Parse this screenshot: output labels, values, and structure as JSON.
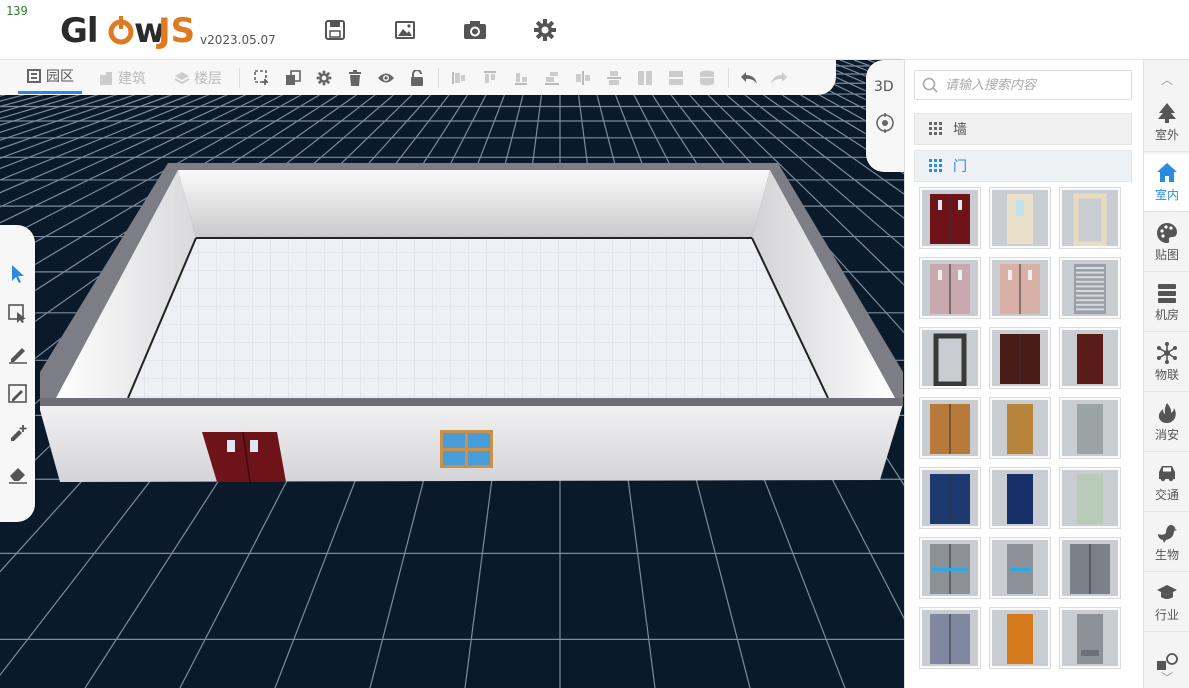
{
  "fps": "139",
  "app": {
    "logo_main": "GlowJS",
    "logo_a": "Gl",
    "logo_b": "w",
    "logo_c": "JS",
    "version": "v2023.05.07"
  },
  "header_icons": [
    "save-icon",
    "image-icon",
    "camera-icon",
    "gear-icon"
  ],
  "toolbar": {
    "tabs": [
      {
        "label": "园区",
        "icon": "park-icon",
        "active": true
      },
      {
        "label": "建筑",
        "icon": "building-icon",
        "active": false
      },
      {
        "label": "楼层",
        "icon": "layers-icon",
        "active": false
      }
    ],
    "actions": [
      "add-object-icon",
      "copy-icon",
      "settings-icon",
      "trash-icon",
      "eye-icon",
      "unlock-icon"
    ],
    "align_actions": [
      "align-left-icon",
      "align-top-icon",
      "align-bottom-left-icon",
      "align-bottom-icon",
      "distribute-h-icon",
      "distribute-v-icon",
      "split-v-icon",
      "split-h-icon",
      "stack-icon"
    ],
    "history": [
      "undo-icon",
      "redo-icon"
    ]
  },
  "left_tools": [
    "select-arrow-icon",
    "box-select-icon",
    "draw-line-icon",
    "edit-shape-icon",
    "add-point-icon",
    "eraser-icon"
  ],
  "view": {
    "mode_label": "3D"
  },
  "asset_panel": {
    "search_placeholder": "请输入搜索内容",
    "categories": [
      {
        "label": "墙",
        "active": false
      },
      {
        "label": "门",
        "active": true
      }
    ],
    "door_thumbnails": [
      "dark-red-double-door",
      "cream-glass-door",
      "door-frame",
      "pink-double-door",
      "peach-double-door",
      "louvered-vent-door",
      "dark-frame-door",
      "brown-double-door",
      "brown-single-door",
      "wood-double-door",
      "wood-single-door",
      "grey-single-door",
      "blue-double-door",
      "navy-single-door",
      "pale-green-door",
      "grey-panic-bar-double-door",
      "grey-panic-bar-door",
      "grey-double-door",
      "grey-double-door-2",
      "orange-single-door",
      "grey-vent-door"
    ]
  },
  "category_sidebar": [
    {
      "label": "室外",
      "icon": "tree-icon",
      "active": false
    },
    {
      "label": "室内",
      "icon": "home-icon",
      "active": true
    },
    {
      "label": "贴图",
      "icon": "palette-icon",
      "active": false
    },
    {
      "label": "机房",
      "icon": "server-icon",
      "active": false
    },
    {
      "label": "物联",
      "icon": "network-icon",
      "active": false
    },
    {
      "label": "消安",
      "icon": "fire-icon",
      "active": false
    },
    {
      "label": "交通",
      "icon": "car-icon",
      "active": false
    },
    {
      "label": "生物",
      "icon": "bird-icon",
      "active": false
    },
    {
      "label": "行业",
      "icon": "graduation-cap-icon",
      "active": false
    },
    {
      "label": "",
      "icon": "shapes-icon",
      "active": false
    }
  ],
  "colors": {
    "accent": "#2a8ae0",
    "logo_orange": "#e07a1e",
    "grid_bg": "#0b1a2a"
  }
}
